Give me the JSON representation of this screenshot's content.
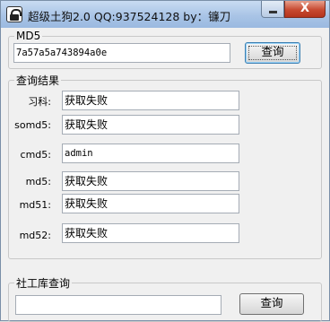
{
  "window": {
    "title": "超级土狗2.0  QQ:937524128 by：镰刀",
    "close_symbol": "X"
  },
  "md5_group": {
    "legend": "MD5",
    "input_value": "7a57a5a743894a0e",
    "query_button": "查询"
  },
  "results_group": {
    "legend": "查询结果",
    "rows": [
      {
        "label": "习科:",
        "value": "获取失败"
      },
      {
        "label": "somd5:",
        "value": "获取失败"
      },
      {
        "label": "cmd5:",
        "value": "admin"
      },
      {
        "label": "md5:",
        "value": "获取失败"
      },
      {
        "label": "md51:",
        "value": "获取失败"
      },
      {
        "label": "md52:",
        "value": "获取失败"
      }
    ]
  },
  "social_group": {
    "legend": "社工库查询",
    "input_value": "",
    "query_button": "查询"
  }
}
